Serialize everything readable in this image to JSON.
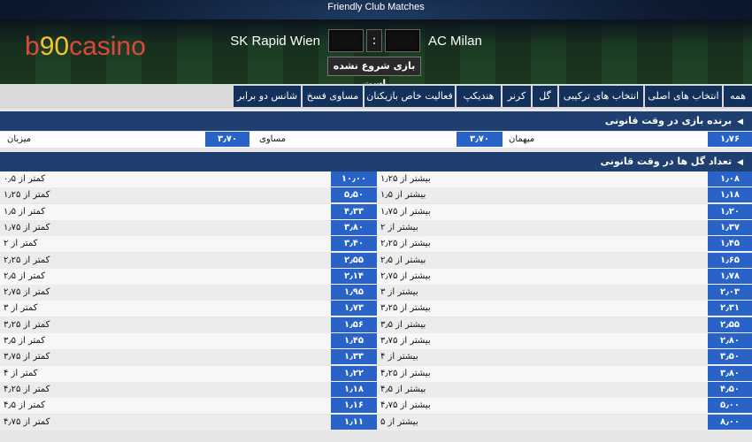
{
  "header": {
    "title": "Friendly Club Matches",
    "logo": {
      "part1": "b",
      "part2": "90",
      "part3": "casino"
    },
    "home_team": "SK Rapid Wien",
    "away_team": "AC Milan",
    "score_separator": ":",
    "status": "بازی شروع نشده است"
  },
  "tabs": [
    "همه",
    "انتخاب های اصلی",
    "انتخاب های ترکیبی",
    "گل",
    "کرنر",
    "هندیکپ",
    "فعالیت خاص بازیکنان",
    "مساوی فسخ",
    "شانس دو برابر"
  ],
  "match_winner": {
    "title": "برنده بازی در وقت قانونی",
    "outcomes": [
      {
        "label": "میزبان",
        "odds": "۳٫۷۰"
      },
      {
        "label": "مساوی",
        "odds": "۳٫۷۰"
      },
      {
        "label": "میهمان",
        "odds": "۱٫۷۶"
      }
    ]
  },
  "total_goals": {
    "title": "تعداد گل ها در وقت قانونی",
    "rows": [
      {
        "over_label": "بیشتر از ۱٫۲۵",
        "over_odds": "۱٫۰۸",
        "under_label": "کمتر از ۰٫۵",
        "under_odds": "۱۰٫۰۰"
      },
      {
        "over_label": "بیشتر از ۱٫۵",
        "over_odds": "۱٫۱۸",
        "under_label": "کمتر از ۱٫۲۵",
        "under_odds": "۵٫۵۰"
      },
      {
        "over_label": "بیشتر از ۱٫۷۵",
        "over_odds": "۱٫۲۰",
        "under_label": "کمتر از ۱٫۵",
        "under_odds": "۴٫۳۳"
      },
      {
        "over_label": "بیشتر از ۲",
        "over_odds": "۱٫۳۷",
        "under_label": "کمتر از ۱٫۷۵",
        "under_odds": "۳٫۸۰"
      },
      {
        "over_label": "بیشتر از ۲٫۲۵",
        "over_odds": "۱٫۴۵",
        "under_label": "کمتر از ۲",
        "under_odds": "۳٫۴۰"
      },
      {
        "over_label": "بیشتر از ۲٫۵",
        "over_odds": "۱٫۶۵",
        "under_label": "کمتر از ۲٫۲۵",
        "under_odds": "۲٫۵۵"
      },
      {
        "over_label": "بیشتر از ۲٫۷۵",
        "over_odds": "۱٫۷۸",
        "under_label": "کمتر از ۲٫۵",
        "under_odds": "۲٫۱۴"
      },
      {
        "over_label": "بیشتر از ۳",
        "over_odds": "۲٫۰۳",
        "under_label": "کمتر از ۲٫۷۵",
        "under_odds": "۱٫۹۵"
      },
      {
        "over_label": "بیشتر از ۳٫۲۵",
        "over_odds": "۲٫۳۱",
        "under_label": "کمتر از ۳",
        "under_odds": "۱٫۷۳"
      },
      {
        "over_label": "بیشتر از ۳٫۵",
        "over_odds": "۲٫۵۵",
        "under_label": "کمتر از ۳٫۲۵",
        "under_odds": "۱٫۵۶"
      },
      {
        "over_label": "بیشتر از ۳٫۷۵",
        "over_odds": "۲٫۸۰",
        "under_label": "کمتر از ۳٫۵",
        "under_odds": "۱٫۴۵"
      },
      {
        "over_label": "بیشتر از ۴",
        "over_odds": "۳٫۵۰",
        "under_label": "کمتر از ۳٫۷۵",
        "under_odds": "۱٫۳۳"
      },
      {
        "over_label": "بیشتر از ۴٫۲۵",
        "over_odds": "۳٫۸۰",
        "under_label": "کمتر از ۴",
        "under_odds": "۱٫۲۲"
      },
      {
        "over_label": "بیشتر از ۴٫۵",
        "over_odds": "۴٫۵۰",
        "under_label": "کمتر از ۴٫۲۵",
        "under_odds": "۱٫۱۸"
      },
      {
        "over_label": "بیشتر از ۴٫۷۵",
        "over_odds": "۵٫۰۰",
        "under_label": "کمتر از ۴٫۵",
        "under_odds": "۱٫۱۶"
      },
      {
        "over_label": "بیشتر از ۵",
        "over_odds": "۸٫۰۰",
        "under_label": "کمتر از ۴٫۷۵",
        "under_odds": "۱٫۱۱"
      }
    ]
  },
  "colors": {
    "accent": "#2a63c7",
    "navy": "#14315c",
    "section": "#1e3f70",
    "logo_red": "#e1473d",
    "logo_yellow": "#f7c232"
  }
}
